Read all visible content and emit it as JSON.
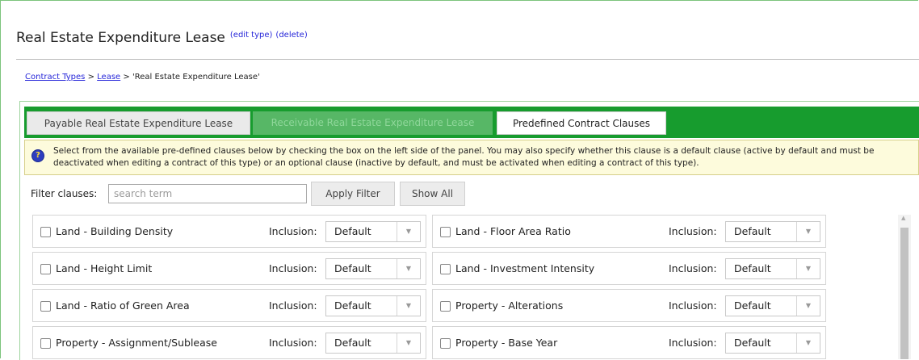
{
  "header": {
    "title": "Real Estate Expenditure Lease",
    "edit_link": "(edit type)",
    "delete_link": "(delete)"
  },
  "breadcrumb": {
    "items": [
      "Contract Types",
      "Lease"
    ],
    "separator": ">",
    "current": "'Real Estate Expenditure Lease'"
  },
  "tabs": [
    {
      "label": "Payable Real Estate Expenditure Lease",
      "state": "inactive"
    },
    {
      "label": "Receivable Real Estate Expenditure Lease",
      "state": "disabled"
    },
    {
      "label": "Predefined Contract Clauses",
      "state": "active"
    }
  ],
  "info": {
    "icon": "question-icon",
    "text": "Select from the available pre-defined clauses below by checking the box on the left side of the panel. You may also specify whether this clause is a default clause (active by default and must be deactivated when editing a contract of this type) or an optional clause (inactive by default, and must be activated when editing a contract of this type)."
  },
  "filter": {
    "label": "Filter clauses:",
    "value": "",
    "placeholder": "search term",
    "apply_label": "Apply Filter",
    "show_all_label": "Show All"
  },
  "clauses": [
    {
      "name": "Land - Building Density",
      "inclusion_label": "Inclusion:",
      "inclusion_value": "Default",
      "checked": false
    },
    {
      "name": "Land - Floor Area Ratio",
      "inclusion_label": "Inclusion:",
      "inclusion_value": "Default",
      "checked": false
    },
    {
      "name": "Land - Height Limit",
      "inclusion_label": "Inclusion:",
      "inclusion_value": "Default",
      "checked": false
    },
    {
      "name": "Land - Investment Intensity",
      "inclusion_label": "Inclusion:",
      "inclusion_value": "Default",
      "checked": false
    },
    {
      "name": "Land - Ratio of Green Area",
      "inclusion_label": "Inclusion:",
      "inclusion_value": "Default",
      "checked": false
    },
    {
      "name": "Property - Alterations",
      "inclusion_label": "Inclusion:",
      "inclusion_value": "Default",
      "checked": false
    },
    {
      "name": "Property - Assignment/Sublease",
      "inclusion_label": "Inclusion:",
      "inclusion_value": "Default",
      "checked": false
    },
    {
      "name": "Property - Base Year",
      "inclusion_label": "Inclusion:",
      "inclusion_value": "Default",
      "checked": false
    }
  ],
  "colors": {
    "tab_bar": "#179c2e",
    "link": "#2626d9",
    "info_background": "#fdfbdc"
  }
}
